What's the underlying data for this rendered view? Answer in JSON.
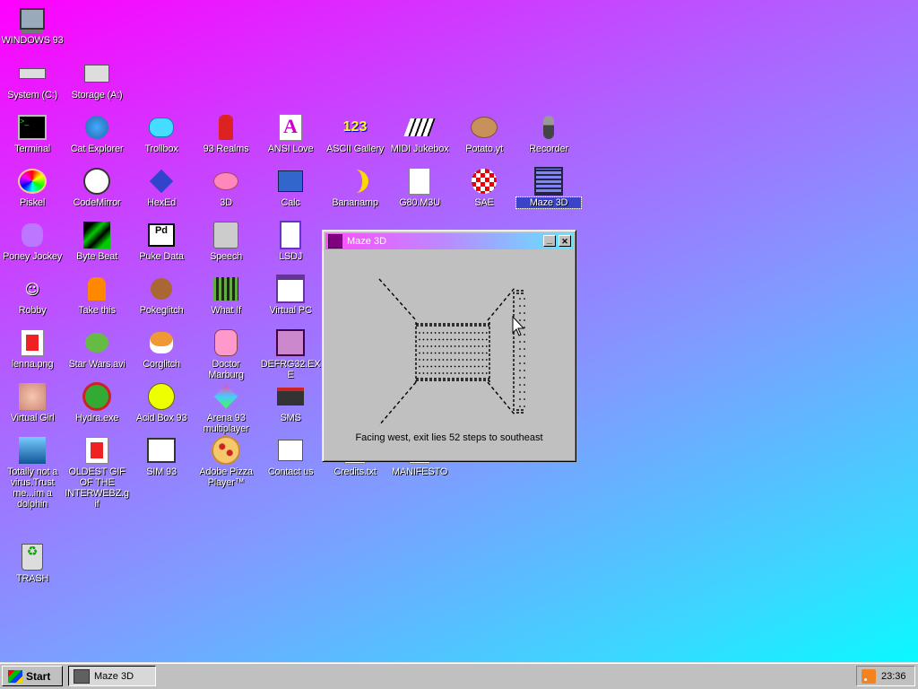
{
  "desktop": {
    "icons": [
      {
        "id": "windows93",
        "label": "WINDOWS 93",
        "icon": "computer-icon"
      },
      {
        "id": "system",
        "label": "System (C:)",
        "icon": "drive-icon"
      },
      {
        "id": "storage",
        "label": "Storage (A:)",
        "icon": "floppy-drive-icon"
      },
      {
        "id": "terminal",
        "label": "Terminal",
        "icon": "terminal-icon"
      },
      {
        "id": "catexplorer",
        "label": "Cat Explorer",
        "icon": "cat-globe-icon"
      },
      {
        "id": "trollbox",
        "label": "Trollbox",
        "icon": "chat-bubble-icon"
      },
      {
        "id": "realms",
        "label": "93 Realms",
        "icon": "knight-icon"
      },
      {
        "id": "ansilove",
        "label": "ANSI Love",
        "icon": "ansi-letter-icon"
      },
      {
        "id": "asciigallery",
        "label": "ASCII Gallery",
        "icon": "numbers-icon"
      },
      {
        "id": "midijukebox",
        "label": "MIDI Jukebox",
        "icon": "piano-icon"
      },
      {
        "id": "potato",
        "label": "Potato.yt",
        "icon": "potato-icon"
      },
      {
        "id": "recorder",
        "label": "Recorder",
        "icon": "microphone-icon"
      },
      {
        "id": "piskel",
        "label": "Piskel",
        "icon": "palette-icon"
      },
      {
        "id": "codemirror",
        "label": "CodeMirror",
        "icon": "cat-mirror-icon"
      },
      {
        "id": "hexed",
        "label": "HexEd",
        "icon": "cube-icon"
      },
      {
        "id": "three-d",
        "label": "3D",
        "icon": "teapot-icon"
      },
      {
        "id": "calc",
        "label": "Calc",
        "icon": "calculator-icon"
      },
      {
        "id": "bananamp",
        "label": "Bananamp",
        "icon": "banana-icon"
      },
      {
        "id": "g80",
        "label": "G80.M3U",
        "icon": "audio-file-icon"
      },
      {
        "id": "sae",
        "label": "SAE",
        "icon": "ball-icon"
      },
      {
        "id": "maze3d",
        "label": "Maze 3D",
        "icon": "maze-icon"
      },
      {
        "id": "poney",
        "label": "Poney Jockey",
        "icon": "pony-icon"
      },
      {
        "id": "bytebeat",
        "label": "Byte Beat",
        "icon": "green-wave-icon"
      },
      {
        "id": "pukedata",
        "label": "Puke Data",
        "icon": "pd-icon"
      },
      {
        "id": "speech",
        "label": "Speech",
        "icon": "face-icon"
      },
      {
        "id": "lsdj",
        "label": "LSDJ",
        "icon": "gameboy-icon"
      },
      {
        "id": "robby",
        "label": "Robby",
        "icon": "stick-figure-icon"
      },
      {
        "id": "takethis",
        "label": "Take this",
        "icon": "pixel-man-icon"
      },
      {
        "id": "pokeglitch",
        "label": "Pokeglitch",
        "icon": "glitch-ball-icon"
      },
      {
        "id": "whatif",
        "label": "What If",
        "icon": "film-icon"
      },
      {
        "id": "virtualpc",
        "label": "Virtual PC",
        "icon": "window-icon"
      },
      {
        "id": "lenna",
        "label": "lenna.png",
        "icon": "image-file-icon"
      },
      {
        "id": "starwars",
        "label": "Star Wars.avi",
        "icon": "yoda-icon"
      },
      {
        "id": "corglitch",
        "label": "Corglitch",
        "icon": "corgi-icon"
      },
      {
        "id": "doctor",
        "label": "Doctor Marburg",
        "icon": "doctor-icon"
      },
      {
        "id": "defrag",
        "label": "DEFRG32.EXE",
        "icon": "defrag-icon"
      },
      {
        "id": "virtualgirl",
        "label": "Virtual Girl",
        "icon": "girl-face-icon"
      },
      {
        "id": "hydra",
        "label": "Hydra.exe",
        "icon": "hydra-icon"
      },
      {
        "id": "acidbox",
        "label": "Acid Box 93",
        "icon": "smiley-icon"
      },
      {
        "id": "arena",
        "label": "Arena 93 multiplayer",
        "icon": "arena-cube-icon"
      },
      {
        "id": "sms",
        "label": "SMS",
        "icon": "console-icon"
      },
      {
        "id": "dolphin",
        "label": "Totally not a virus.Trust me...im a dolphin",
        "icon": "dolphin-icon"
      },
      {
        "id": "oldestgif",
        "label": "OLDEST GIF OF THE INTERWEBZ.gif",
        "icon": "image-file-icon"
      },
      {
        "id": "sim93",
        "label": "SIM 93",
        "icon": "sim-icon"
      },
      {
        "id": "pizza",
        "label": "Adobe Pizza Player™",
        "icon": "pizza-icon"
      },
      {
        "id": "contact",
        "label": "Contact us",
        "icon": "letter-icon"
      },
      {
        "id": "credits",
        "label": "Credits.txt",
        "icon": "text-file-icon"
      },
      {
        "id": "manifesto",
        "label": "MANIFESTO",
        "icon": "text-file-icon"
      },
      {
        "id": "trash",
        "label": "TRASH",
        "icon": "recycle-bin-icon"
      }
    ]
  },
  "window": {
    "title": "Maze 3D",
    "minimize_label": "_",
    "close_label": "✕",
    "status": "Facing west, exit lies 52 steps to southeast"
  },
  "taskbar": {
    "start_label": "Start",
    "task_label": "Maze 3D",
    "clock": "23:36"
  },
  "colors": {
    "selection": "#3b44c9",
    "window_gray": "#c0c0c0"
  }
}
